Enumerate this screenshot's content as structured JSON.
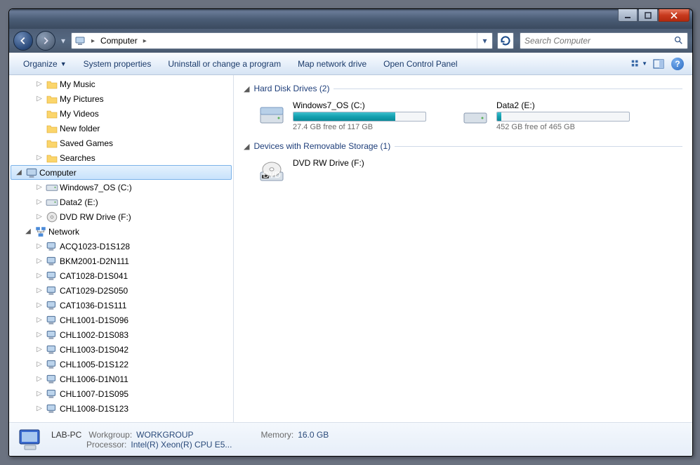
{
  "address": {
    "location": "Computer",
    "search_placeholder": "Search Computer"
  },
  "toolbar": {
    "organize": "Organize",
    "sysprops": "System properties",
    "uninstall": "Uninstall or change a program",
    "mapdrive": "Map network drive",
    "controlpanel": "Open Control Panel"
  },
  "tree": {
    "music": "My Music",
    "pictures": "My Pictures",
    "videos": "My Videos",
    "newfolder": "New folder",
    "savedgames": "Saved Games",
    "searches": "Searches",
    "computer": "Computer",
    "drive_c": "Windows7_OS (C:)",
    "drive_e": "Data2 (E:)",
    "drive_f": "DVD RW Drive (F:)",
    "network": "Network",
    "hosts": [
      "ACQ1023-D1S128",
      "BKM2001-D2N111",
      "CAT1028-D1S041",
      "CAT1029-D2S050",
      "CAT1036-D1S111",
      "CHL1001-D1S096",
      "CHL1002-D1S083",
      "CHL1003-D1S042",
      "CHL1005-D1S122",
      "CHL1006-D1N011",
      "CHL1007-D1S095",
      "CHL1008-D1S123"
    ]
  },
  "groups": {
    "hdd": "Hard Disk Drives (2)",
    "removable": "Devices with Removable Storage (1)"
  },
  "drives": {
    "c": {
      "name": "Windows7_OS (C:)",
      "free": "27.4 GB free of 117 GB",
      "fill": 77
    },
    "e": {
      "name": "Data2 (E:)",
      "free": "452 GB free of 465 GB",
      "fill": 3
    },
    "f": {
      "name": "DVD RW Drive (F:)"
    }
  },
  "details": {
    "name": "LAB-PC",
    "workgroup_label": "Workgroup:",
    "workgroup": "WORKGROUP",
    "processor_label": "Processor:",
    "processor": "Intel(R) Xeon(R) CPU E5...",
    "memory_label": "Memory:",
    "memory": "16.0 GB"
  }
}
